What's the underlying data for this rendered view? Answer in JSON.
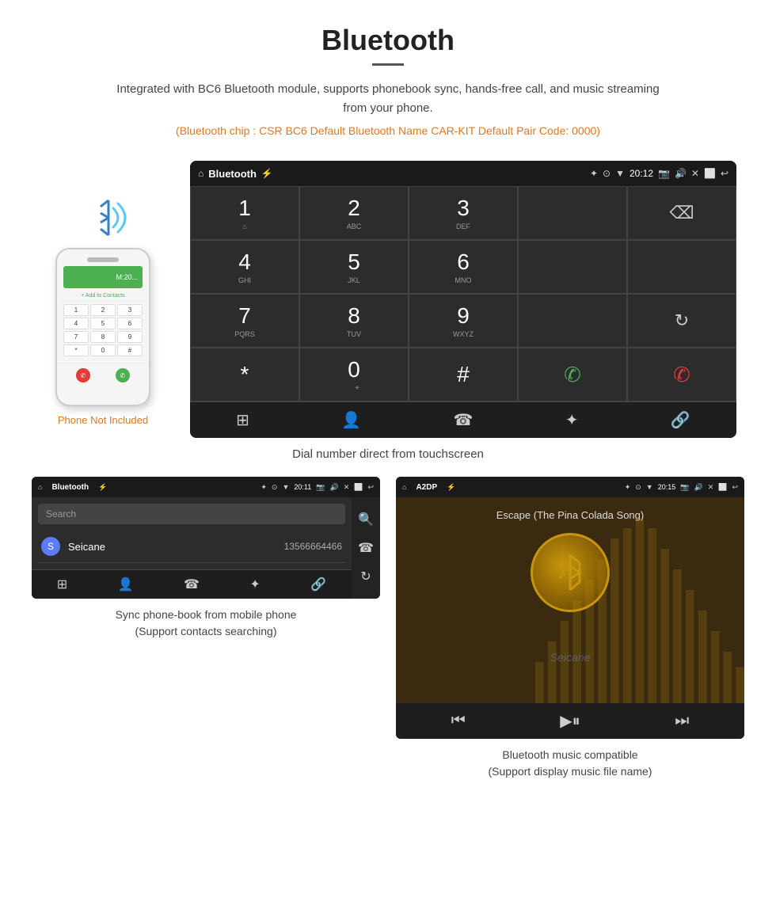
{
  "header": {
    "title": "Bluetooth",
    "description": "Integrated with BC6 Bluetooth module, supports phonebook sync, hands-free call, and music streaming from your phone.",
    "specs": "(Bluetooth chip : CSR BC6   Default Bluetooth Name CAR-KIT    Default Pair Code: 0000)"
  },
  "phone_label": "Phone Not Included",
  "dialer_screen": {
    "status_bar": {
      "title": "Bluetooth",
      "time": "20:12"
    },
    "keys": [
      {
        "number": "1",
        "sub": ""
      },
      {
        "number": "2",
        "sub": "ABC"
      },
      {
        "number": "3",
        "sub": "DEF"
      },
      {
        "number": "",
        "sub": ""
      },
      {
        "number": "⌫",
        "sub": ""
      },
      {
        "number": "4",
        "sub": "GHI"
      },
      {
        "number": "5",
        "sub": "JKL"
      },
      {
        "number": "6",
        "sub": "MNO"
      },
      {
        "number": "",
        "sub": ""
      },
      {
        "number": "",
        "sub": ""
      },
      {
        "number": "7",
        "sub": "PQRS"
      },
      {
        "number": "8",
        "sub": "TUV"
      },
      {
        "number": "9",
        "sub": "WXYZ"
      },
      {
        "number": "",
        "sub": ""
      },
      {
        "number": "↻",
        "sub": ""
      },
      {
        "number": "*",
        "sub": ""
      },
      {
        "number": "0",
        "sub": "+"
      },
      {
        "number": "#",
        "sub": ""
      },
      {
        "number": "✆",
        "sub": "green"
      },
      {
        "number": "✆",
        "sub": "red"
      }
    ]
  },
  "dialer_caption": "Dial number direct from touchscreen",
  "phonebook_screen": {
    "status_bar": {
      "title": "Bluetooth",
      "time": "20:11"
    },
    "search_placeholder": "Search",
    "contacts": [
      {
        "letter": "S",
        "name": "Seicane",
        "number": "13566664466"
      }
    ]
  },
  "phonebook_caption_line1": "Sync phone-book from mobile phone",
  "phonebook_caption_line2": "(Support contacts searching)",
  "music_screen": {
    "status_bar": {
      "title": "A2DP",
      "time": "20:15"
    },
    "song_title": "Escape (The Pina Colada Song)"
  },
  "music_caption_line1": "Bluetooth music compatible",
  "music_caption_line2": "(Support display music file name)",
  "watermark": "Seicane"
}
